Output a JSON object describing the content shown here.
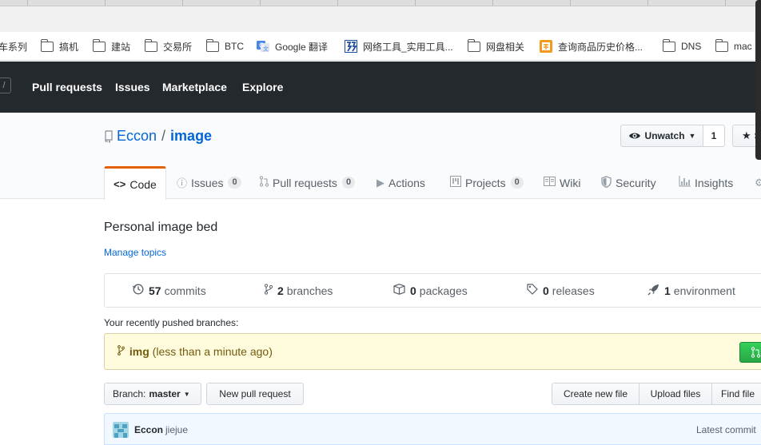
{
  "bookmarks": [
    {
      "label": "车系列",
      "icon": "folder-icon"
    },
    {
      "label": "搞机",
      "icon": "folder-icon"
    },
    {
      "label": "建站",
      "icon": "folder-icon"
    },
    {
      "label": "交易所",
      "icon": "folder-icon"
    },
    {
      "label": "BTC",
      "icon": "folder-icon"
    },
    {
      "label": "Google 翻译",
      "icon": "google-translate-icon"
    },
    {
      "label": "网络工具_实用工具...",
      "icon": "network-tools-icon"
    },
    {
      "label": "网盘相关",
      "icon": "folder-icon"
    },
    {
      "label": "查询商品历史价格...",
      "icon": "price-history-icon"
    },
    {
      "label": "DNS",
      "icon": "folder-icon"
    },
    {
      "label": "mac",
      "icon": "folder-icon"
    }
  ],
  "header": {
    "search_hint": "/",
    "nav": [
      "Pull requests",
      "Issues",
      "Marketplace",
      "Explore"
    ]
  },
  "repo": {
    "owner": "Eccon",
    "separator": "/",
    "name": "image",
    "watch_label": "Unwatch",
    "watch_count": "1",
    "star_label": "S"
  },
  "tabs": [
    {
      "label": "Code",
      "icon": "code-icon",
      "count": null,
      "selected": true
    },
    {
      "label": "Issues",
      "icon": "issue-icon",
      "count": "0"
    },
    {
      "label": "Pull requests",
      "icon": "pull-request-icon",
      "count": "0"
    },
    {
      "label": "Actions",
      "icon": "play-icon",
      "count": null
    },
    {
      "label": "Projects",
      "icon": "project-icon",
      "count": "0"
    },
    {
      "label": "Wiki",
      "icon": "book-icon",
      "count": null
    },
    {
      "label": "Security",
      "icon": "shield-icon",
      "count": null
    },
    {
      "label": "Insights",
      "icon": "graph-icon",
      "count": null
    }
  ],
  "description": "Personal image bed",
  "manage_topics": "Manage topics",
  "summary": {
    "commits_count": "57",
    "commits_label": "commits",
    "branches_count": "2",
    "branches_label": "branches",
    "packages_count": "0",
    "packages_label": "packages",
    "releases_count": "0",
    "releases_label": "releases",
    "environment_count": "1",
    "environment_label": "environment"
  },
  "recent": {
    "label": "Your recently pushed branches:",
    "branch": "img",
    "time": "(less than a minute ago)"
  },
  "file_nav": {
    "branch_prefix": "Branch:",
    "branch_name": "master",
    "new_pr": "New pull request",
    "create_file": "Create new file",
    "upload_files": "Upload files",
    "find_file": "Find file"
  },
  "commit": {
    "author": "Eccon",
    "message": "jiejue",
    "latest": "Latest commit"
  },
  "colors": {
    "header_bg": "#24292e",
    "link": "#0366d6",
    "tab_accent": "#e36209",
    "recent_bg": "#fffbdd",
    "compare_green": "#28a745"
  }
}
